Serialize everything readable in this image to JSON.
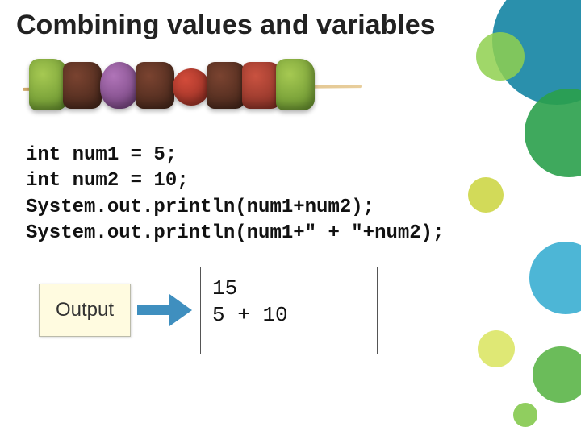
{
  "title": "Combining values and variables",
  "code": {
    "line1": "int num1 = 5;",
    "line2": "int num2 = 10;",
    "line3": "System.out.println(num1+num2);",
    "line4": "System.out.println(num1+\" + \"+num2);"
  },
  "output_label": "Output",
  "output": {
    "line1": "15",
    "line2": "5 + 10"
  },
  "illustration_alt": "kebab skewer"
}
